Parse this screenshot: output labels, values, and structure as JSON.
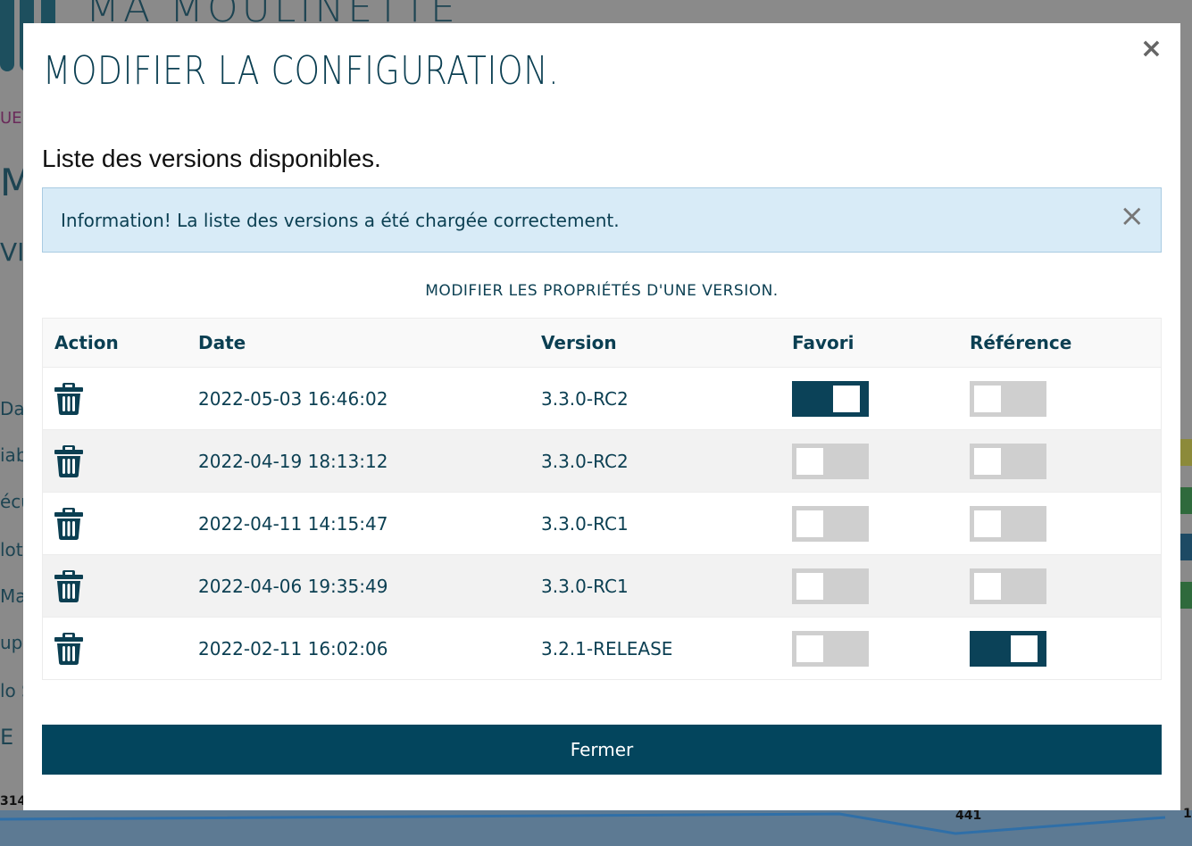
{
  "background": {
    "app_title": "MA MOULINETTE",
    "fragments": [
      "UEL",
      "MC",
      "VI",
      "Date",
      "iab",
      "écu",
      "lots",
      "Mai",
      "upr",
      "lo S",
      "E"
    ],
    "chart_labels": [
      "314",
      "441",
      "1"
    ]
  },
  "modal": {
    "title": "MODIFIER LA CONFIGURATION.",
    "close_symbol": "×",
    "section_title": "Liste des versions disponibles.",
    "alert": {
      "strong": "Information!",
      "message": "La liste des versions a été chargée correctement.",
      "close_symbol": "×"
    },
    "table_caption": "Modifier les propriétés d'une version.",
    "table": {
      "headers": {
        "action": "Action",
        "date": "Date",
        "version": "Version",
        "favori": "Favori",
        "reference": "Référence"
      },
      "rows": [
        {
          "date": "2022-05-03 16:46:02",
          "version": "3.3.0-RC2",
          "favori": true,
          "reference": false
        },
        {
          "date": "2022-04-19 18:13:12",
          "version": "3.3.0-RC2",
          "favori": false,
          "reference": false
        },
        {
          "date": "2022-04-11 14:15:47",
          "version": "3.3.0-RC1",
          "favori": false,
          "reference": false
        },
        {
          "date": "2022-04-06 19:35:49",
          "version": "3.3.0-RC1",
          "favori": false,
          "reference": false
        },
        {
          "date": "2022-02-11 16:02:06",
          "version": "3.2.1-RELEASE",
          "favori": false,
          "reference": true
        }
      ]
    },
    "close_button": "Fermer"
  },
  "colors": {
    "primary": "#03455d",
    "text": "#0b3f52",
    "alert_bg": "#d8ebf7",
    "toggle_off": "#cfcfcf",
    "overlay": "#7f7f7f"
  }
}
